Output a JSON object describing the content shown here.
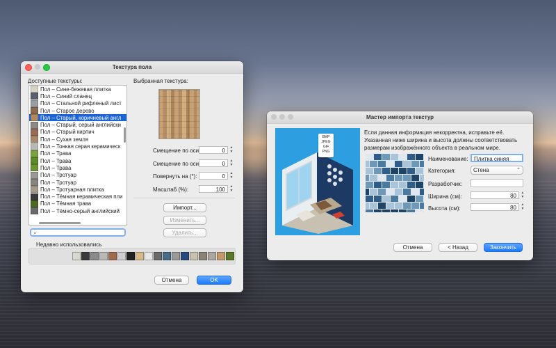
{
  "floor_dialog": {
    "title": "Текстура пола",
    "available_label": "Доступные текстуры:",
    "selected_label": "Выбранная текстура:",
    "textures": [
      {
        "label": "Пол – Сине-бежевая плитка",
        "color": "#d8d4c4",
        "selected": false
      },
      {
        "label": "Пол – Синий сланец",
        "color": "#5a6072",
        "selected": false
      },
      {
        "label": "Пол – Стальной рифленый лист",
        "color": "#9a9ea4",
        "selected": false
      },
      {
        "label": "Пол – Старое дерево",
        "color": "#8a6a4e",
        "selected": false
      },
      {
        "label": "Пол – Старый, коричневый англ",
        "color": "#b08a5e",
        "selected": true
      },
      {
        "label": "Пол – Старый, серый английски",
        "color": "#8c8a86",
        "selected": false
      },
      {
        "label": "Пол – Старый кирпич",
        "color": "#9a6c58",
        "selected": false
      },
      {
        "label": "Пол – Сухая земля",
        "color": "#a88a6a",
        "selected": false
      },
      {
        "label": "Пол – Тонкая серая керамическ",
        "color": "#b8b8b4",
        "selected": false
      },
      {
        "label": "Пол – Трава",
        "color": "#7aa040",
        "selected": false
      },
      {
        "label": "Пол – Трава",
        "color": "#5c8a2a",
        "selected": false
      },
      {
        "label": "Пол – Трава",
        "color": "#6a9432",
        "selected": false
      },
      {
        "label": "Пол – Тротуар",
        "color": "#9a9894",
        "selected": false
      },
      {
        "label": "Пол – Тротуар",
        "color": "#86847e",
        "selected": false
      },
      {
        "label": "Пол – Тротуарная плитка",
        "color": "#a89a88",
        "selected": false
      },
      {
        "label": "Пол – Тёмная керамическая пли",
        "color": "#3a3a3a",
        "selected": false
      },
      {
        "label": "Пол – Тёмная трава",
        "color": "#4a6a24",
        "selected": false
      },
      {
        "label": "Пол – Тёмно-серый английский",
        "color": "#6a6a6a",
        "selected": false
      }
    ],
    "search_placeholder": "",
    "fields": [
      {
        "label": "Смещение по оси X (%):",
        "value": "0"
      },
      {
        "label": "Смещение по оси Y (%):",
        "value": "0"
      },
      {
        "label": "Повернуть на (°):",
        "value": "0"
      },
      {
        "label": "Масштаб (%):",
        "value": "100"
      }
    ],
    "import_button": "Импорт...",
    "modify_button": "Изменить...",
    "delete_button": "Удалить...",
    "recent_label": "Недавно использовались",
    "recent_colors": [
      "#d8d8d0",
      "#3a3a3a",
      "#8a8a8a",
      "#b8b8b8",
      "#a06a4e",
      "#cfcfcf",
      "#222222",
      "#d8b88a",
      "#e8e8e8",
      "#6a6a6a",
      "#4a6a8a",
      "#9a9a9a",
      "#2a4a7a",
      "#c8c0b0",
      "#8a8478",
      "#aaa6a0",
      "#c09a6a",
      "#5a7a2a"
    ],
    "cancel_button": "Отмена",
    "ok_button": "OK"
  },
  "import_wizard": {
    "title": "Мастер импорта текстур",
    "formats": [
      "BMP",
      "JPEG",
      "GIF",
      "PNG"
    ],
    "description": "Если данная информация некорректна, исправьте её. Указанная ниже ширина и высота должны соответствовать размерам изображённого объекта в реальном мире.",
    "name_label": "Наименование:",
    "name_value": "Плитка синяя",
    "category_label": "Категория:",
    "category_value": "Стена",
    "developer_label": "Разработчик:",
    "developer_value": "",
    "width_label": "Ширина (см):",
    "width_value": "80",
    "height_label": "Высота (см):",
    "height_value": "80",
    "cancel_button": "Отмена",
    "back_button": "< Назад",
    "finish_button": "Закончить"
  }
}
